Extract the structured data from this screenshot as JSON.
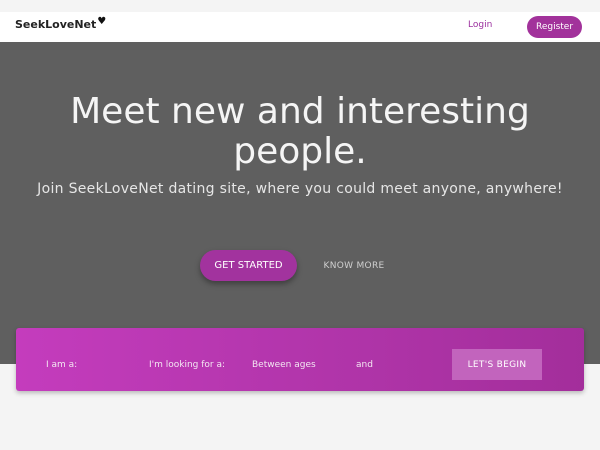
{
  "header": {
    "logo_text": "SeekLoveNet",
    "logo_heart": "♥",
    "login_label": "Login",
    "register_label": "Register"
  },
  "hero": {
    "title": "Meet new and interesting people.",
    "subtitle": "Join SeekLoveNet dating site, where you could meet anyone, anywhere!",
    "primary_button": "GET STARTED",
    "secondary_button": "KNOW MORE"
  },
  "search": {
    "i_am_label": "I am a:",
    "looking_for_label": "I'm looking for a:",
    "between_ages_label": "Between ages",
    "and_label": "and",
    "submit_label": "LET'S BEGIN"
  },
  "colors": {
    "brand": "#a2329b",
    "hero_bg": "#5f5f5f",
    "panel_gradient_start": "#c43cbd",
    "panel_gradient_end": "#a32e9b"
  }
}
